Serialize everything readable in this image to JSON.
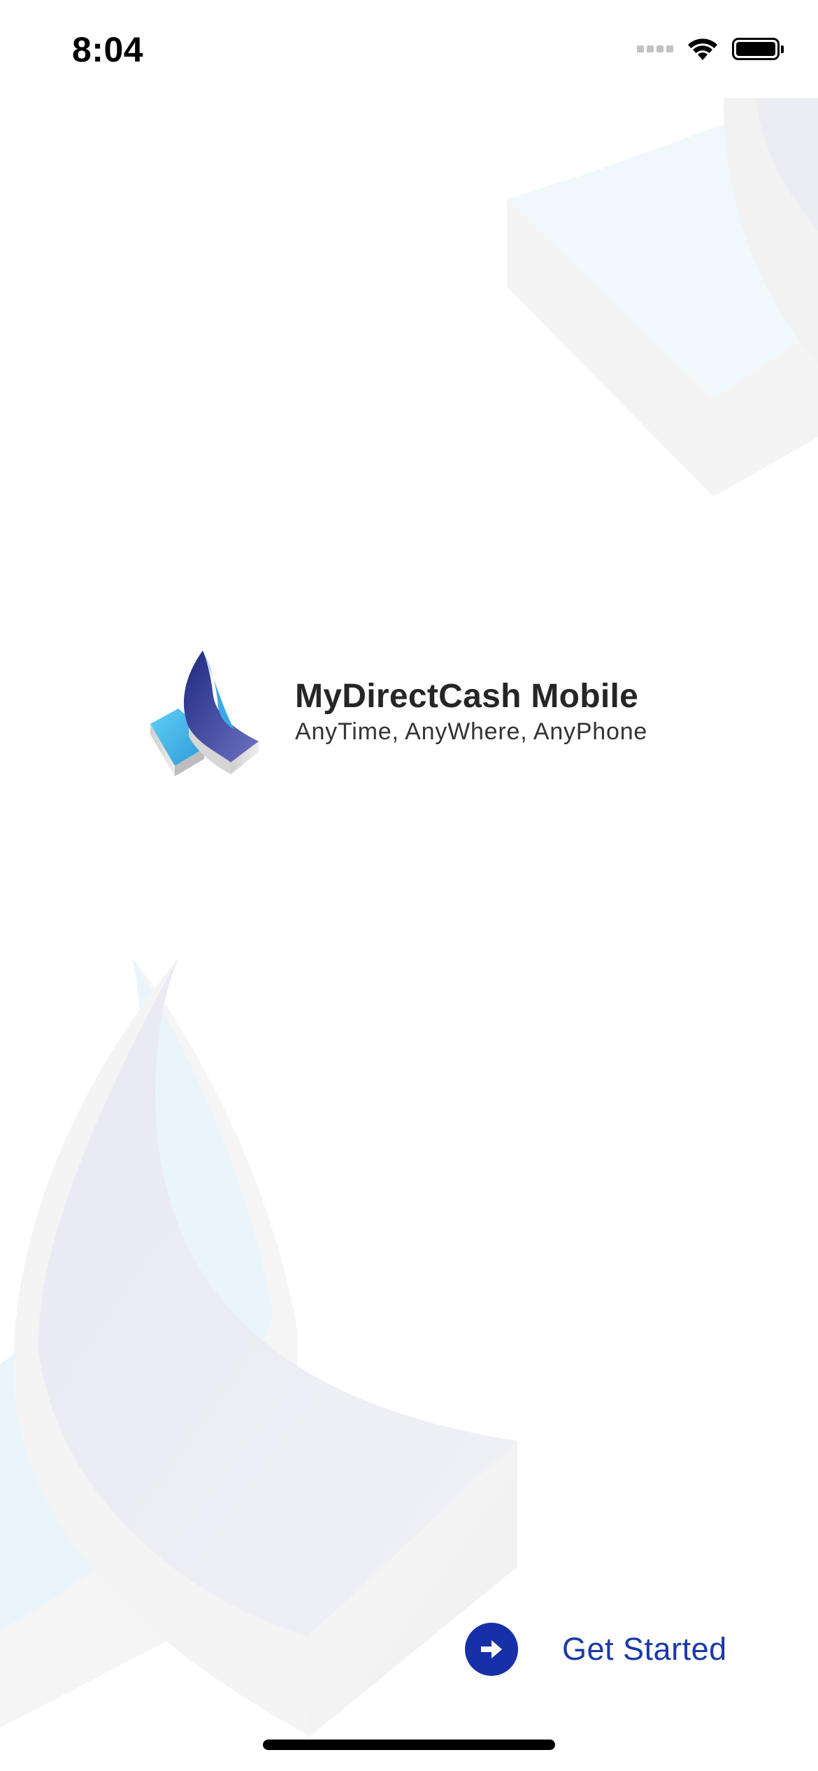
{
  "status_bar": {
    "time": "8:04"
  },
  "brand": {
    "title": "MyDirectCash Mobile",
    "tagline": "AnyTime, AnyWhere, AnyPhone"
  },
  "actions": {
    "get_started_label": "Get Started"
  },
  "icons": {
    "wifi": "wifi-icon",
    "battery": "battery-icon",
    "signal": "signal-icon",
    "arrow": "arrow-right-icon"
  },
  "colors": {
    "accent": "#1730a8",
    "link": "#1b39a8",
    "logo_dark": "#2a2f86",
    "logo_light": "#45b8e8"
  }
}
